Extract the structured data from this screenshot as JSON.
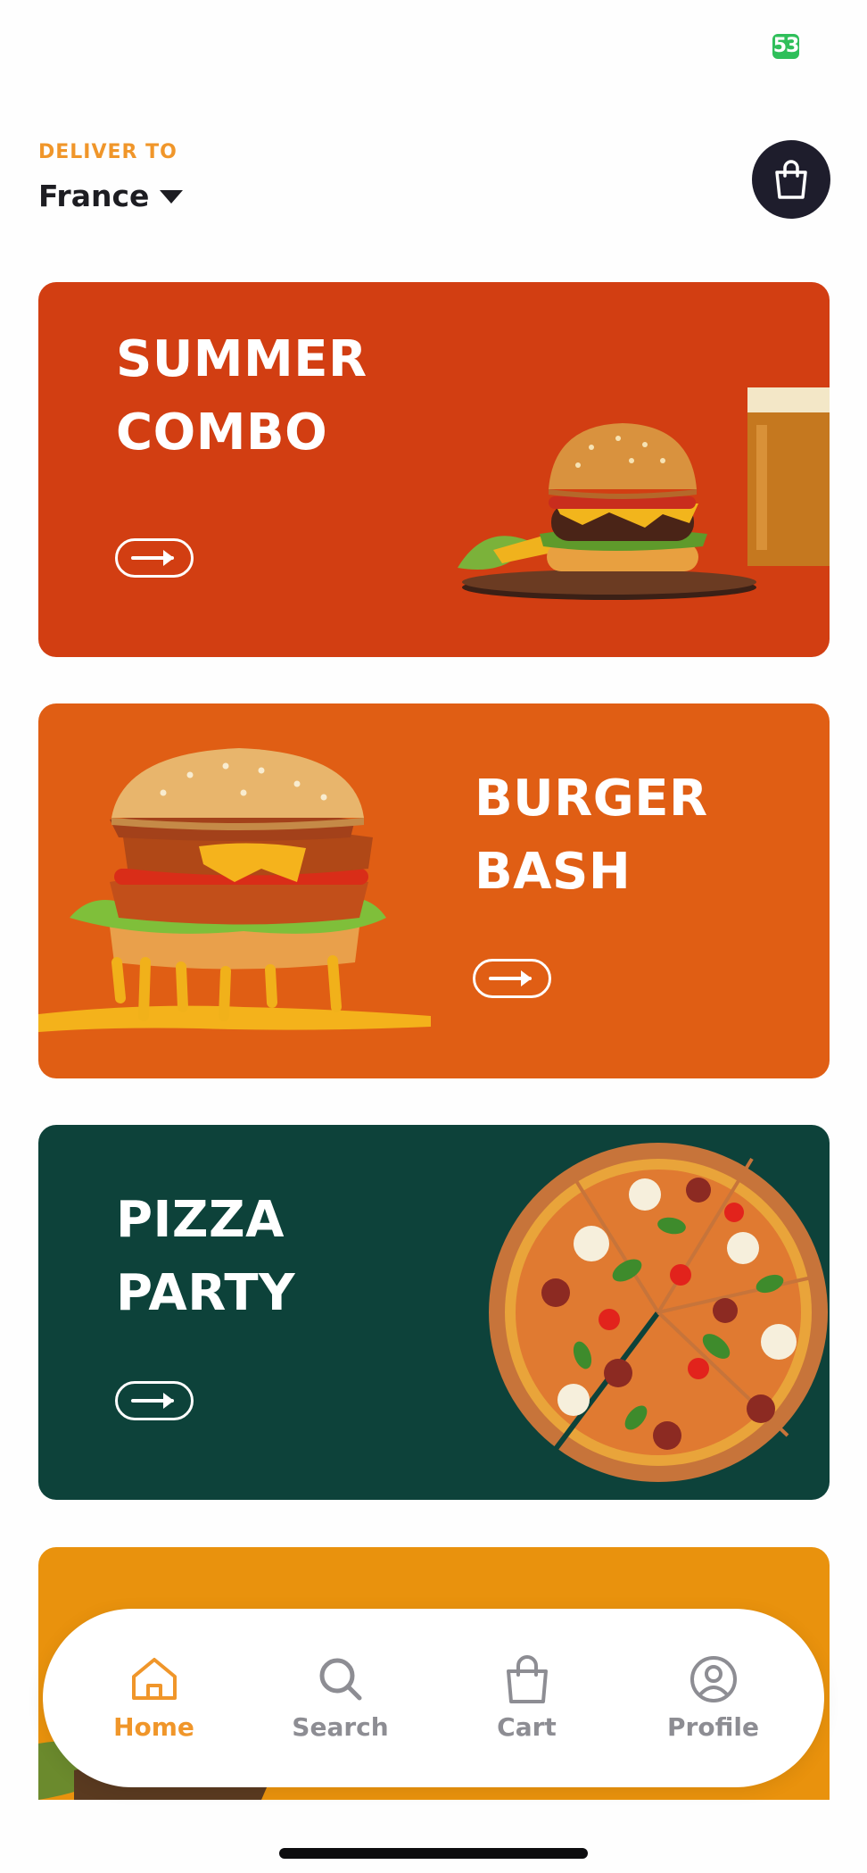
{
  "status_bar": {
    "battery": "53"
  },
  "header": {
    "deliver_label": "DELIVER TO",
    "location": "France"
  },
  "colors": {
    "accent": "#f0962a",
    "summer_bg": "#d23e12",
    "burger_bg": "#e05e14",
    "pizza_bg": "#0d423a",
    "fourth_bg": "#e9920d",
    "dark_button": "#1e1d2c"
  },
  "promos": [
    {
      "line1": "SUMMER",
      "line2": "COMBO"
    },
    {
      "line1": "BURGER",
      "line2": "BASH"
    },
    {
      "line1": "PIZZA",
      "line2": "PARTY"
    }
  ],
  "tabbar": [
    {
      "label": "Home",
      "icon": "home-icon",
      "active": true
    },
    {
      "label": "Search",
      "icon": "search-icon",
      "active": false
    },
    {
      "label": "Cart",
      "icon": "bag-icon",
      "active": false
    },
    {
      "label": "Profile",
      "icon": "profile-icon",
      "active": false
    }
  ]
}
